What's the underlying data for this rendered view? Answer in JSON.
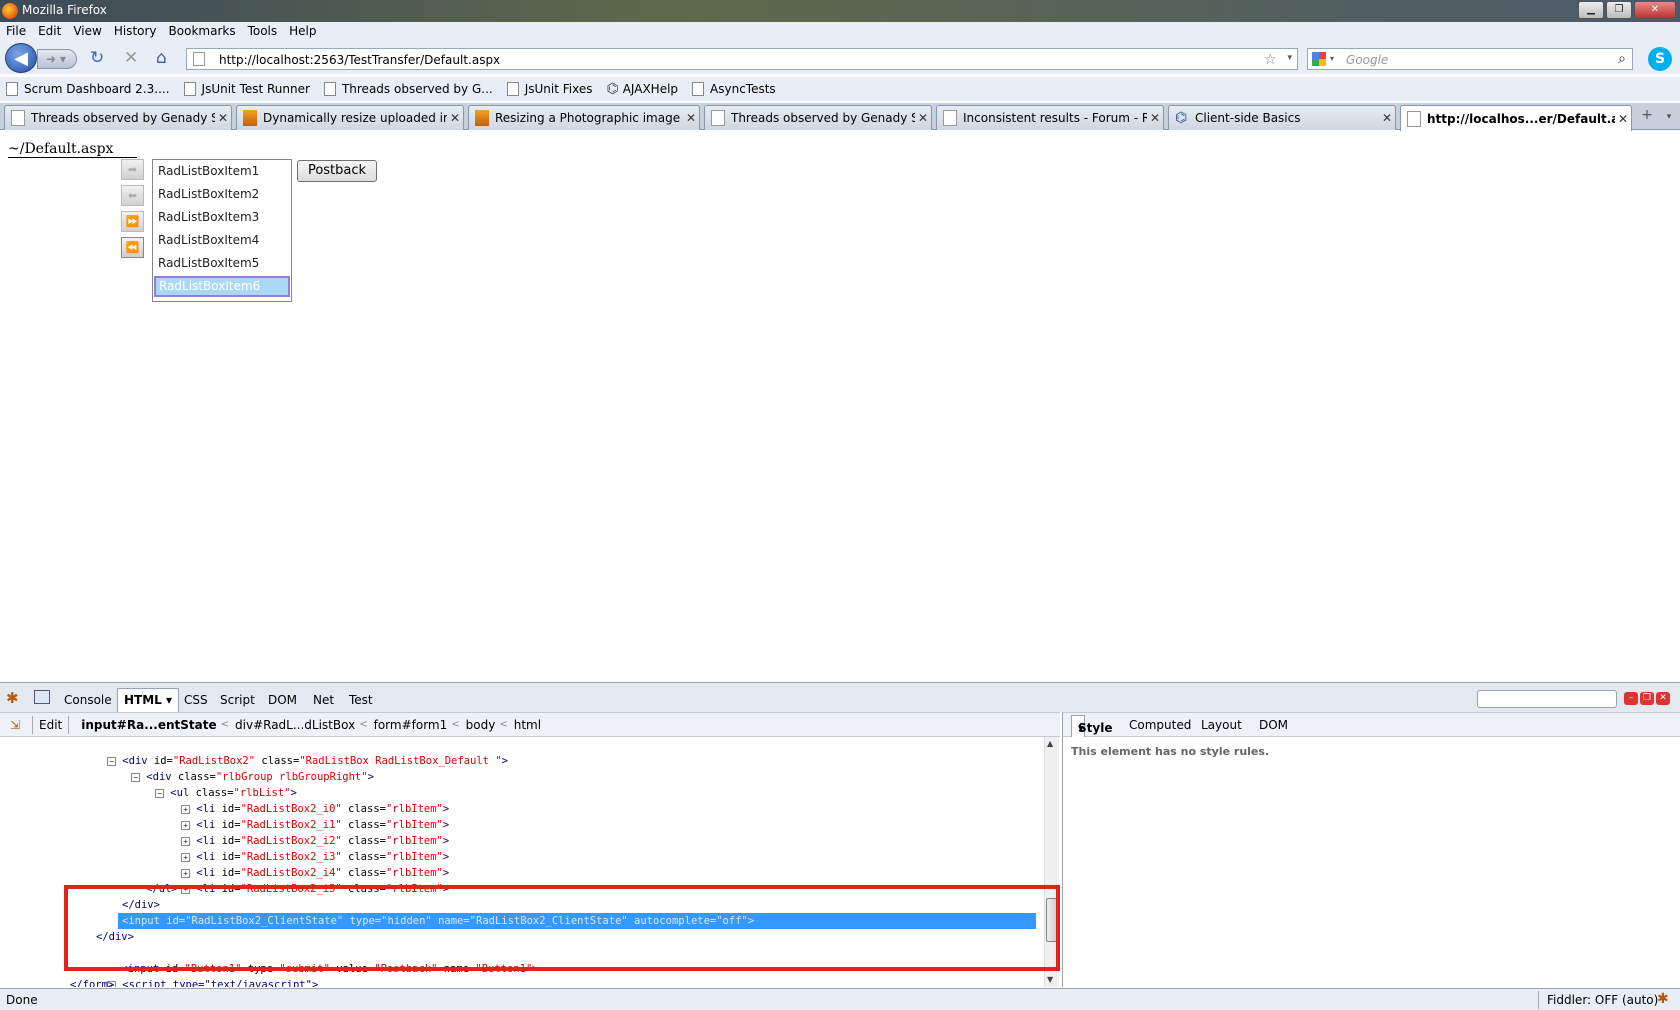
{
  "window": {
    "title": "Mozilla Firefox"
  },
  "menu": [
    "File",
    "Edit",
    "View",
    "History",
    "Bookmarks",
    "Tools",
    "Help"
  ],
  "nav": {
    "url": "http://localhost:2563/TestTransfer/Default.aspx",
    "search_placeholder": "Google"
  },
  "bookmarks": [
    "Scrum Dashboard 2.3....",
    "JsUnit Test Runner",
    "Threads observed by G...",
    "JsUnit Fixes",
    "AJAXHelp",
    "AsyncTests"
  ],
  "tabs": [
    {
      "label": "Threads observed by Genady Ser...",
      "icon": "page-icon"
    },
    {
      "label": "Dynamically resize uploaded im...",
      "icon": "image-icon"
    },
    {
      "label": "Resizing a Photographic image ...",
      "icon": "image-icon"
    },
    {
      "label": "Threads observed by Genady Ser...",
      "icon": "page-icon"
    },
    {
      "label": "Inconsistent results - Forum - Ra...",
      "icon": "page-icon"
    },
    {
      "label": "Client-side Basics",
      "icon": "telerik-icon"
    },
    {
      "label": "http://localhos...er/Default.aspx",
      "icon": "page-icon",
      "active": true
    }
  ],
  "page": {
    "path_label": "~/Default.aspx",
    "listbox_items": [
      "RadListBoxItem1",
      "RadListBoxItem2",
      "RadListBoxItem3",
      "RadListBoxItem4",
      "RadListBoxItem5",
      "RadListBoxItem6"
    ],
    "selected_item": "RadListBoxItem6",
    "postback_label": "Postback"
  },
  "firebug": {
    "tabs": [
      "Console",
      "HTML",
      "CSS",
      "Script",
      "DOM",
      "Net",
      "Test"
    ],
    "active_tab": "HTML",
    "edit_label": "Edit",
    "breadcrumbs": [
      "input#Ra...entState",
      "div#RadL...dListBox",
      "form#form1",
      "body",
      "html"
    ],
    "side_tabs": [
      "Style",
      "Computed",
      "Layout",
      "DOM"
    ],
    "side_message": "This element has no style rules.",
    "code": {
      "l1": {
        "tag": "<div ",
        "a1": "id=",
        "v1": "\"RadListBox2\"",
        "a2": " class=",
        "v2": "\"RadListBox RadListBox_Default \"",
        "end": ">"
      },
      "l2": {
        "tag": "<div ",
        "a1": "class=",
        "v1": "\"rlbGroup rlbGroupRight\"",
        "end": ">"
      },
      "l3": {
        "tag": "<ul ",
        "a1": "class=",
        "v1": "\"rlbList\"",
        "end": ">"
      },
      "items": [
        {
          "tag": "<li ",
          "a1": "id=",
          "v1": "\"RadListBox2_i0\"",
          "a2": " class=",
          "v2": "\"rlbItem\"",
          "end": ">"
        },
        {
          "tag": "<li ",
          "a1": "id=",
          "v1": "\"RadListBox2_i1\"",
          "a2": " class=",
          "v2": "\"rlbItem\"",
          "end": ">"
        },
        {
          "tag": "<li ",
          "a1": "id=",
          "v1": "\"RadListBox2_i2\"",
          "a2": " class=",
          "v2": "\"rlbItem\"",
          "end": ">"
        },
        {
          "tag": "<li ",
          "a1": "id=",
          "v1": "\"RadListBox2_i3\"",
          "a2": " class=",
          "v2": "\"rlbItem\"",
          "end": ">"
        },
        {
          "tag": "<li ",
          "a1": "id=",
          "v1": "\"RadListBox2_i4\"",
          "a2": " class=",
          "v2": "\"rlbItem\"",
          "end": ">"
        },
        {
          "tag": "<li ",
          "a1": "id=",
          "v1": "\"RadListBox2_i5\"",
          "a2": " class=",
          "v2": "\"rlbItem\"",
          "end": ">"
        }
      ],
      "close_ul": "</ul>",
      "close_div1": "</div>",
      "hidden_input": "<input id=\"RadListBox2_ClientState\" type=\"hidden\" name=\"RadListBox2_ClientState\" autocomplete=\"off\">",
      "close_div2": "</div>",
      "button_line": {
        "tag": "<input ",
        "a1": "id=",
        "v1": "\"Button1\"",
        "a2": " type=",
        "v2": "\"submit\"",
        "a3": " value=",
        "v3": "\"Postback\"",
        "a4": " name=",
        "v4": "\"Button1\"",
        "end": ">"
      },
      "script_line": "<script type=\"text/javascript\">",
      "close_form": "</form>"
    }
  },
  "status": {
    "text": "Done",
    "fiddler": "Fiddler: OFF (auto)"
  }
}
